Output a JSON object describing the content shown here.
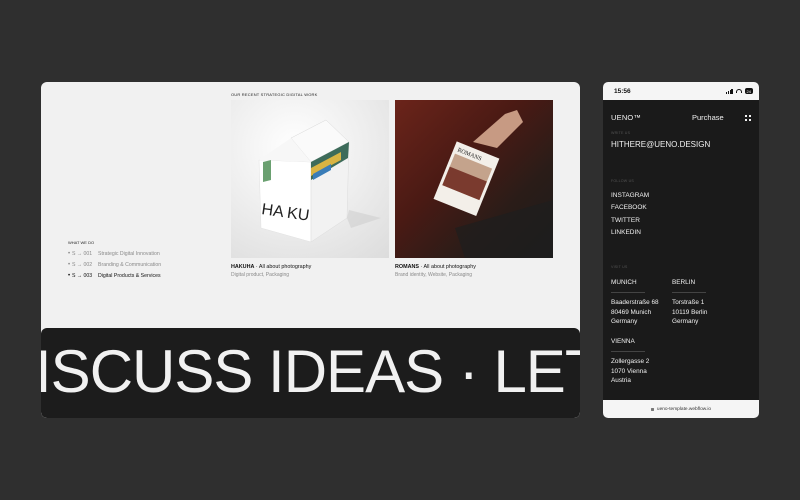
{
  "desktop": {
    "recent_label": "OUR RECENT STRATEGIC DIGITAL WORK",
    "what_label": "WHAT WE DO",
    "services": [
      {
        "num": "S → 001",
        "label": "Strategic Digital Innovation"
      },
      {
        "num": "S → 002",
        "label": "Branding & Communication"
      },
      {
        "num": "S → 003",
        "label": "Digital Products & Services"
      }
    ],
    "projects": [
      {
        "name": "HAKUHA",
        "tagline": " · All about photography",
        "sub": "Digital product, Packaging",
        "box_text": "HA KU"
      },
      {
        "name": "ROMANS",
        "tagline": " · All about photography",
        "sub": "Brand identity, Website, Packaging",
        "card_text": "ROMANS"
      }
    ],
    "marquee": "ISCUSS IDEAS · LET’"
  },
  "phone": {
    "status_time": "15:56",
    "battery": "24",
    "logo": "UENO™",
    "purchase": "Purchase",
    "write_label": "WRITE US",
    "email": "HITHERE@UENO.DESIGN",
    "follow_label": "FOLLOW US",
    "links": [
      "INSTAGRAM",
      "FACEBOOK",
      "TWITTER",
      "LINKEDIN"
    ],
    "visit_label": "VISIT US",
    "offices": [
      {
        "city": "MUNICH",
        "lines": [
          "Baaderstraße 68",
          "80469 Munich",
          "Germany"
        ]
      },
      {
        "city": "BERLIN",
        "lines": [
          "Torstraße 1",
          "10119 Berlin",
          "Germany"
        ]
      },
      {
        "city": "VIENNA",
        "lines": [
          "Zollergasse 2",
          "1070 Vienna",
          "Austria"
        ]
      }
    ],
    "url": "ueno-template.webflow.io"
  },
  "colors": {
    "background": "#2f2f2f",
    "desktop_bg": "#f1f1f1",
    "dark": "#1a1a1a"
  },
  "icons": [
    "signal-icon",
    "wifi-icon",
    "battery-icon",
    "menu-grid-icon",
    "lock-icon"
  ]
}
